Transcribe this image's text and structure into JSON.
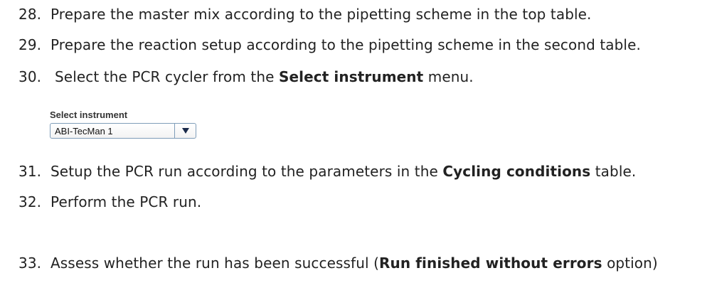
{
  "steps": [
    {
      "number": "28.",
      "text": "Prepare the master mix according to the pipetting scheme in the top table."
    },
    {
      "number": "29.",
      "text": "Prepare the reaction setup according to the pipetting scheme in the second table."
    },
    {
      "number": "30.",
      "text_before": "Select the PCR cycler from the ",
      "bold": "Select instrument",
      "text_after": " menu."
    },
    {
      "number": "31.",
      "text_before": "Setup the PCR run according to the parameters in the ",
      "bold": "Cycling conditions",
      "text_after": " table."
    },
    {
      "number": "32.",
      "text": "Perform the PCR run."
    },
    {
      "number": "33.",
      "text_before": "Assess whether the run has been successful (",
      "bold": "Run finished without errors",
      "text_after": " option)"
    }
  ],
  "select_instrument": {
    "label": "Select instrument",
    "value": "ABI-TecMan 1",
    "icon": "triangle-down-icon"
  }
}
